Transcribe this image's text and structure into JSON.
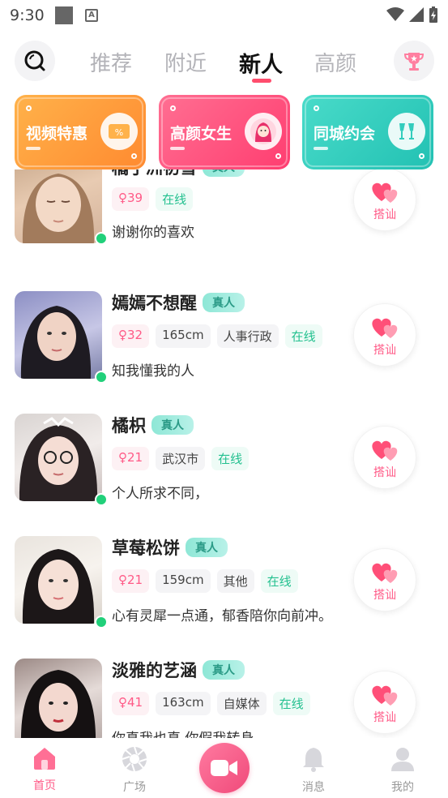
{
  "status_bar": {
    "time": "9:30"
  },
  "tabs": [
    {
      "label": "推荐",
      "active": false
    },
    {
      "label": "附近",
      "active": false
    },
    {
      "label": "新人",
      "active": true
    },
    {
      "label": "高颜",
      "active": false
    }
  ],
  "banners": [
    {
      "label": "视频特惠",
      "icon": "discount-ticket-icon",
      "color": "#ff9a3c"
    },
    {
      "label": "高颜女生",
      "icon": "girl-avatar-icon",
      "color": "#ff4f7b"
    },
    {
      "label": "同城约会",
      "icon": "cheers-icon",
      "color": "#2fd1c0"
    }
  ],
  "users": [
    {
      "name": "橘子洲初雪",
      "badge": "真人",
      "tags": [
        "39",
        "在线"
      ],
      "bio": "谢谢你的喜欢",
      "greet": "搭讪"
    },
    {
      "name": "嫣嫣不想醒",
      "badge": "真人",
      "tags": [
        "32",
        "165cm",
        "人事行政",
        "在线"
      ],
      "bio": "知我懂我的人",
      "greet": "搭讪"
    },
    {
      "name": "橘枳",
      "badge": "真人",
      "tags": [
        "21",
        "武汉市",
        "在线"
      ],
      "bio": "个人所求不同，",
      "greet": "搭讪"
    },
    {
      "name": "草莓松饼",
      "badge": "真人",
      "tags": [
        "21",
        "159cm",
        "其他",
        "在线"
      ],
      "bio": "心有灵犀一点通，郁香陪你向前冲。",
      "greet": "搭讪"
    },
    {
      "name": "淡雅的艺涵",
      "badge": "真人",
      "tags": [
        "41",
        "163cm",
        "自媒体",
        "在线"
      ],
      "bio": "你真我也真 你假我转身",
      "greet": "搭讪"
    }
  ],
  "bottom_nav": [
    {
      "label": "首页",
      "icon": "home-icon",
      "active": true
    },
    {
      "label": "广场",
      "icon": "plaza-aperture-icon",
      "active": false
    },
    {
      "label": "",
      "icon": "video-camera-icon",
      "active": false
    },
    {
      "label": "消息",
      "icon": "bell-icon",
      "active": false
    },
    {
      "label": "我的",
      "icon": "profile-icon",
      "active": false
    }
  ],
  "colors": {
    "accent": "#ff5a87",
    "online": "#21d07a",
    "real_badge": "#8ee7d6"
  }
}
